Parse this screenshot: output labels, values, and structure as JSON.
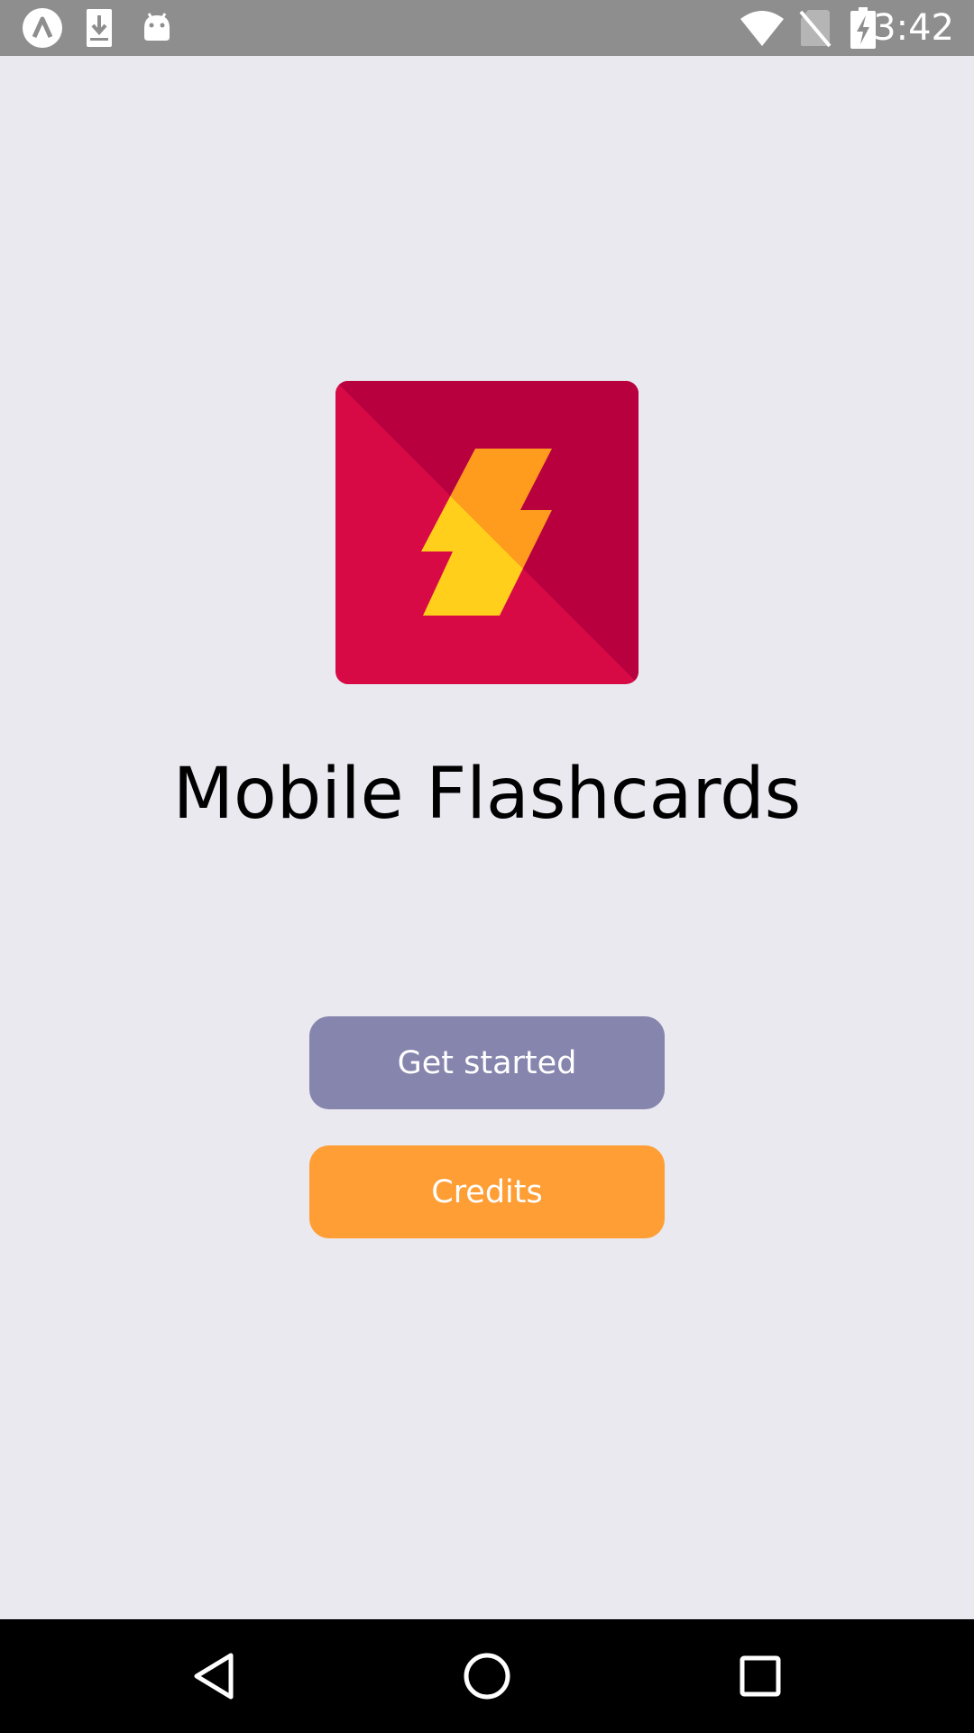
{
  "status_bar": {
    "time": "3:42",
    "left_icons": [
      "app-notification-icon",
      "download-icon",
      "android-icon"
    ],
    "right_icons": [
      "wifi-icon",
      "no-sim-icon",
      "battery-charging-icon"
    ]
  },
  "main": {
    "app_title": "Mobile Flashcards",
    "logo_icon": "lightning-bolt-logo",
    "get_started_label": "Get started",
    "credits_label": "Credits"
  },
  "nav_bar": {
    "buttons": [
      "back-icon",
      "home-icon",
      "recents-icon"
    ]
  },
  "colors": {
    "background": "#eae9f0",
    "status_bar": "#8e8e8e",
    "logo_dark": "#b8003f",
    "logo_light": "#d70a46",
    "bolt_orange": "#ff9b1d",
    "bolt_yellow": "#ffcf1c",
    "get_started_button": "#8685ad",
    "credits_button": "#ff9e35",
    "nav_bar": "#000000"
  }
}
